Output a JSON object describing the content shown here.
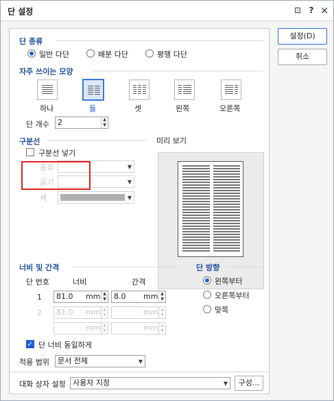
{
  "window": {
    "title": "단 설정",
    "help": "?",
    "close": "×",
    "pin": "⊡"
  },
  "buttons": {
    "ok": "설정(D)",
    "cancel": "취소"
  },
  "type": {
    "heading": "단 종류",
    "options": [
      "일반 다단",
      "배분 다단",
      "평행 다단"
    ],
    "selected": 0
  },
  "presets": {
    "heading": "자주 쓰이는 모양",
    "items": [
      "하나",
      "둘",
      "셋",
      "왼쪽",
      "오른쪽"
    ],
    "selected": 1
  },
  "count": {
    "label": "단 개수",
    "value": "2"
  },
  "divider": {
    "heading": "구분선",
    "checkbox": "구분선 넣기",
    "checked": false,
    "type_label": "종류",
    "thickness_label": "굵기",
    "color_label": "색"
  },
  "preview": {
    "label": "미리 보기"
  },
  "spacing": {
    "heading": "너비 및 간격",
    "col_header": "단 번호",
    "width_header": "너비",
    "gap_header": "간격",
    "rows": [
      {
        "num": "1",
        "width": "81.0",
        "unit1": "mm",
        "gap": "8.0",
        "unit2": "mm"
      },
      {
        "num": "2",
        "width": "81.0",
        "unit1": "mm",
        "gap": "",
        "unit2": "mm"
      },
      {
        "num": "",
        "width": "",
        "unit1": "mm",
        "gap": "",
        "unit2": "mm"
      }
    ],
    "equal_label": "단 너비 동일하게",
    "equal_checked": true
  },
  "direction": {
    "heading": "단 방향",
    "options": [
      "왼쪽부터",
      "오른쪽부터",
      "맞쪽"
    ],
    "selected": 0
  },
  "apply": {
    "label": "적용 범위",
    "value": "문서 전체"
  },
  "dialog_settings": {
    "label": "대화 상자 설정",
    "value": "사용자 지정",
    "button": "구성..."
  }
}
